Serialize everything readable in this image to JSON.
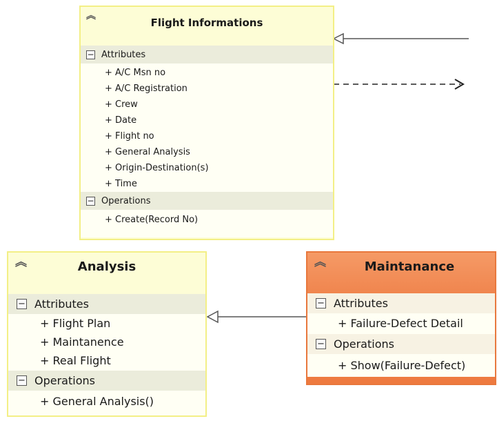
{
  "classes": {
    "flight": {
      "title": "Flight Informations",
      "attributes_label": "Attributes",
      "attributes": [
        "+ A/C Msn no",
        "+ A/C Registration",
        "+ Crew",
        "+ Date",
        "+ Flight no",
        "+ General Analysis",
        "+ Origin-Destination(s)",
        "+ Time"
      ],
      "operations_label": "Operations",
      "operations": [
        "+ Create(Record No)"
      ]
    },
    "analysis": {
      "title": "Analysis",
      "attributes_label": "Attributes",
      "attributes": [
        "+ Flight Plan",
        "+ Maintanence",
        "+ Real Flight"
      ],
      "operations_label": "Operations",
      "operations": [
        "+ General Analysis()"
      ]
    },
    "maintanance": {
      "title": "Maintanance",
      "attributes_label": "Attributes",
      "attributes": [
        "+ Failure-Defect Detail"
      ],
      "operations_label": "Operations",
      "operations": [
        "+ Show(Failure-Defect)"
      ]
    }
  },
  "colors": {
    "class_fill": "#fdfdd6",
    "class_border": "#f3ef86",
    "highlight_fill": "#ee7a3f",
    "connector": "#555555"
  }
}
